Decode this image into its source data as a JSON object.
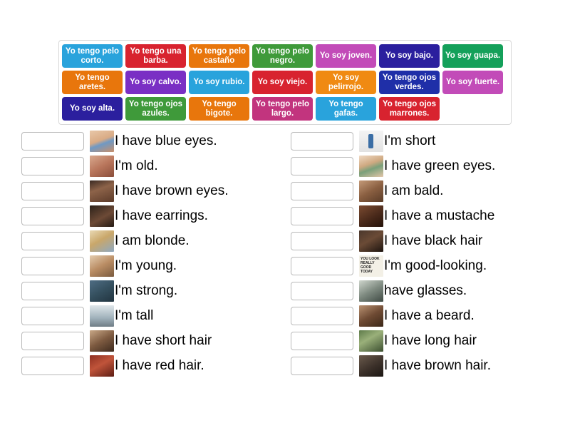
{
  "word_bank": {
    "rows": [
      [
        {
          "label": "Yo tengo pelo corto.",
          "color": "#29a3dc"
        },
        {
          "label": "Yo tengo una barba.",
          "color": "#d8232f"
        },
        {
          "label": "Yo tengo pelo castaño",
          "color": "#e8760c"
        },
        {
          "label": "Yo tengo pelo negro.",
          "color": "#3f9a3a"
        },
        {
          "label": "Yo soy joven.",
          "color": "#c24bb8"
        },
        {
          "label": "Yo soy bajo.",
          "color": "#2b1f9e"
        },
        {
          "label": "Yo soy guapa.",
          "color": "#14a05a"
        }
      ],
      [
        {
          "label": "Yo tengo aretes.",
          "color": "#e8760c"
        },
        {
          "label": "Yo soy calvo.",
          "color": "#7a2fc4"
        },
        {
          "label": "Yo soy rubio.",
          "color": "#29a3dc"
        },
        {
          "label": "Yo soy viejo.",
          "color": "#d8232f"
        },
        {
          "label": "Yo soy pelirrojo.",
          "color": "#f08a12"
        },
        {
          "label": "Yo tengo ojos verdes.",
          "color": "#1f2fa8"
        },
        {
          "label": "Yo soy fuerte.",
          "color": "#c24bb8"
        }
      ],
      [
        {
          "label": "Yo soy alta.",
          "color": "#2b1f9e"
        },
        {
          "label": "Yo tengo ojos azules.",
          "color": "#3f9a3a"
        },
        {
          "label": "Yo tengo bigote.",
          "color": "#e8760c"
        },
        {
          "label": "Yo tengo pelo largo.",
          "color": "#c2347e"
        },
        {
          "label": "Yo tengo gafas.",
          "color": "#29a3dc"
        },
        {
          "label": "Yo tengo ojos marrones.",
          "color": "#d8232f"
        }
      ]
    ]
  },
  "answers": {
    "left": [
      {
        "text": "I have blue eyes.",
        "thumb": "blue-eyes-photo",
        "thumb_class": "t-blueeyes",
        "slot_value": ""
      },
      {
        "text": "I'm old.",
        "thumb": "old-man-photo",
        "thumb_class": "t-old",
        "slot_value": ""
      },
      {
        "text": "I have brown eyes.",
        "thumb": "brown-eyes-photo",
        "thumb_class": "t-browneyes",
        "slot_value": ""
      },
      {
        "text": "I have earrings.",
        "thumb": "earrings-photo",
        "thumb_class": "t-earrings",
        "slot_value": ""
      },
      {
        "text": "I am blonde.",
        "thumb": "blonde-photo",
        "thumb_class": "t-blonde",
        "slot_value": ""
      },
      {
        "text": "I'm young.",
        "thumb": "young-person-photo",
        "thumb_class": "t-young",
        "slot_value": ""
      },
      {
        "text": "I'm strong.",
        "thumb": "strong-person-photo",
        "thumb_class": "t-strong",
        "slot_value": ""
      },
      {
        "text": "I'm tall",
        "thumb": "tall-person-photo",
        "thumb_class": "t-tall",
        "slot_value": ""
      },
      {
        "text": "I have short hair",
        "thumb": "short-hair-photo",
        "thumb_class": "t-shorthair",
        "slot_value": ""
      },
      {
        "text": "I have red hair.",
        "thumb": "red-hair-photo",
        "thumb_class": "t-redhair",
        "slot_value": ""
      }
    ],
    "right": [
      {
        "text": "I'm short",
        "thumb": "short-person-photo",
        "thumb_class": "t-short",
        "slot_value": ""
      },
      {
        "text": "I have green eyes.",
        "thumb": "green-eyes-photo",
        "thumb_class": "t-greeneyes",
        "slot_value": ""
      },
      {
        "text": "I am bald.",
        "thumb": "bald-man-photo",
        "thumb_class": "t-bald",
        "slot_value": ""
      },
      {
        "text": "I have a mustache",
        "thumb": "mustache-photo",
        "thumb_class": "t-mustache",
        "slot_value": ""
      },
      {
        "text": "I have black hair",
        "thumb": "black-hair-photo",
        "thumb_class": "t-blackhair",
        "slot_value": ""
      },
      {
        "text": "I'm good-looking.",
        "thumb": "good-looking-note-photo",
        "thumb_class": "t-goodlook",
        "slot_value": ""
      },
      {
        "text": "have glasses.",
        "thumb": "glasses-photo",
        "thumb_class": "t-glasses",
        "slot_value": ""
      },
      {
        "text": "I have a beard.",
        "thumb": "beard-photo",
        "thumb_class": "t-beard",
        "slot_value": ""
      },
      {
        "text": "I have long hair",
        "thumb": "long-hair-photo",
        "thumb_class": "t-longhair",
        "slot_value": ""
      },
      {
        "text": "I have brown hair.",
        "thumb": "brown-hair-photo",
        "thumb_class": "t-brownhair",
        "slot_value": ""
      }
    ]
  }
}
